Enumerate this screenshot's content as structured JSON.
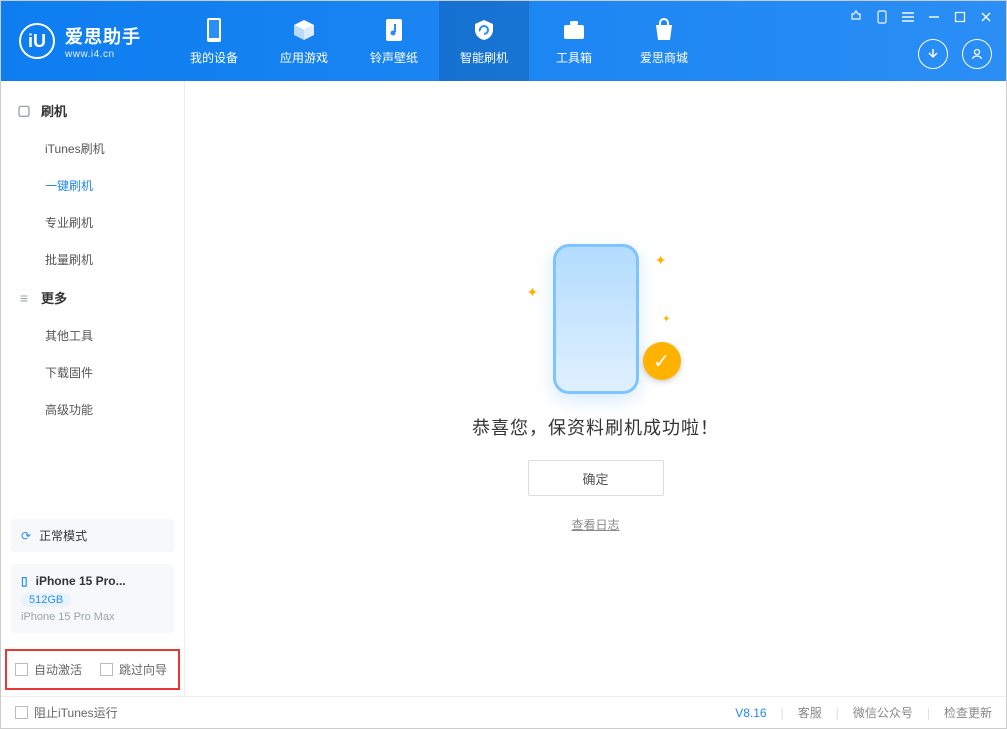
{
  "app": {
    "title": "爱思助手",
    "subtitle": "www.i4.cn"
  },
  "nav": {
    "items": [
      {
        "label": "我的设备"
      },
      {
        "label": "应用游戏"
      },
      {
        "label": "铃声壁纸"
      },
      {
        "label": "智能刷机"
      },
      {
        "label": "工具箱"
      },
      {
        "label": "爱思商城"
      }
    ]
  },
  "sidebar": {
    "group1": {
      "title": "刷机",
      "items": [
        "iTunes刷机",
        "一键刷机",
        "专业刷机",
        "批量刷机"
      ]
    },
    "group2": {
      "title": "更多",
      "items": [
        "其他工具",
        "下载固件",
        "高级功能"
      ]
    },
    "mode": "正常模式",
    "device": {
      "name": "iPhone 15 Pro...",
      "storage": "512GB",
      "full": "iPhone 15 Pro Max"
    },
    "checks": {
      "auto_activate": "自动激活",
      "skip_wizard": "跳过向导"
    }
  },
  "main": {
    "success": "恭喜您，保资料刷机成功啦！",
    "ok": "确定",
    "view_log": "查看日志"
  },
  "footer": {
    "block_itunes": "阻止iTunes运行",
    "version": "V8.16",
    "support": "客服",
    "wechat": "微信公众号",
    "update": "检查更新"
  }
}
